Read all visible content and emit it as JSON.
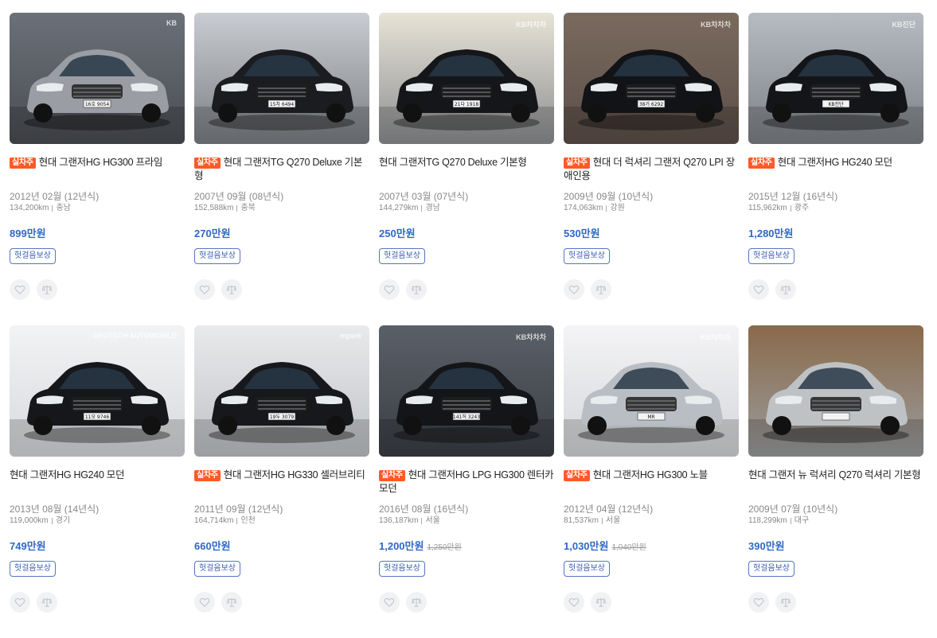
{
  "listings": [
    {
      "title": "현대 그랜저HG HG300 프라임",
      "badge": "실차주",
      "year": "2012년 02월 (12년식)",
      "mileage": "134,200km",
      "region": "충남",
      "price": "899만원",
      "old_price": "",
      "tag": "헛걸음보상",
      "car_color": "#9a9ea4",
      "bg_top": "#6b7079",
      "bg_bottom": "#4a4d52",
      "plate": "16호 9054",
      "watermark": "KB"
    },
    {
      "title": "현대 그랜저TG Q270 Deluxe 기본형",
      "badge": "실차주",
      "year": "2007년 09월 (08년식)",
      "mileage": "152,588km",
      "region": "충북",
      "price": "270만원",
      "old_price": "",
      "tag": "헛걸음보상",
      "car_color": "#1b1c20",
      "bg_top": "#c9cdd2",
      "bg_bottom": "#7b7f83",
      "plate": "15차 6494",
      "watermark": ""
    },
    {
      "title": "현대 그랜저TG Q270 Deluxe 기본형",
      "badge": "",
      "year": "2007년 03월 (07년식)",
      "mileage": "144,279km",
      "region": "경남",
      "price": "250만원",
      "old_price": "",
      "tag": "헛걸음보상",
      "car_color": "#151619",
      "bg_top": "#e7e3d6",
      "bg_bottom": "#8d8f92",
      "plate": "21다 1918",
      "watermark": "KB차차차"
    },
    {
      "title": "현대 더 럭셔리 그랜저 Q270 LPI 장애인용",
      "badge": "실차주",
      "year": "2009년 09월 (10년식)",
      "mileage": "174,063km",
      "region": "강원",
      "price": "530만원",
      "old_price": "",
      "tag": "헛걸음보상",
      "car_color": "#121316",
      "bg_top": "#7a6a5e",
      "bg_bottom": "#5c4f49",
      "plate": "38거 6292",
      "watermark": "KB차차차"
    },
    {
      "title": "현대 그랜저HG HG240 모던",
      "badge": "실차주",
      "year": "2015년 12월 (16년식)",
      "mileage": "115,962km",
      "region": "광주",
      "price": "1,280만원",
      "old_price": "",
      "tag": "헛걸음보상",
      "car_color": "#141518",
      "bg_top": "#b7bcc2",
      "bg_bottom": "#7d8186",
      "plate": "KB진단",
      "watermark": "KB진단"
    },
    {
      "title": "현대 그랜저HG HG240 모던",
      "badge": "",
      "year": "2013년 08월 (14년식)",
      "mileage": "119,000km",
      "region": "경기",
      "price": "749만원",
      "old_price": "",
      "tag": "헛걸음보상",
      "car_color": "#16171a",
      "bg_top": "#f2f3f5",
      "bg_bottom": "#d7d9dc",
      "plate": "11모 9746",
      "watermark": "DEUTSCH AUTOWORLD"
    },
    {
      "title": "현대 그랜저HG HG330 셀러브리티",
      "badge": "실차주",
      "year": "2011년 09월 (12년식)",
      "mileage": "164,714km",
      "region": "인천",
      "price": "660만원",
      "old_price": "",
      "tag": "헛걸음보상",
      "car_color": "#17181b",
      "bg_top": "#e9eaec",
      "bg_bottom": "#bfc2c5",
      "plate": "19두 3079",
      "watermark": "mpark"
    },
    {
      "title": "현대 그랜저HG LPG HG300 렌터카 모던",
      "badge": "실차주",
      "year": "2016년 08월 (16년식)",
      "mileage": "136,187km",
      "region": "서울",
      "price": "1,200만원",
      "old_price": "1,250만원",
      "tag": "헛걸음보상",
      "car_color": "#141518",
      "bg_top": "#5a6068",
      "bg_bottom": "#3a3e44",
      "plate": "141허 3243",
      "watermark": "KB차차차"
    },
    {
      "title": "현대 그랜저HG HG300 노블",
      "badge": "실차주",
      "year": "2012년 04월 (12년식)",
      "mileage": "81,537km",
      "region": "서울",
      "price": "1,030만원",
      "old_price": "1,040만원",
      "tag": "헛걸음보상",
      "car_color": "#b9bec4",
      "bg_top": "#f4f4f6",
      "bg_bottom": "#d4d6d9",
      "plate": "MR",
      "watermark": "KB차차차"
    },
    {
      "title": "현대 그랜저 뉴 럭셔리 Q270 럭셔리 기본형",
      "badge": "",
      "year": "2009년 07월 (10년식)",
      "mileage": "118,299km",
      "region": "대구",
      "price": "390만원",
      "old_price": "",
      "tag": "헛걸음보상",
      "car_color": "#bfc2c4",
      "bg_top": "#8a6a4a",
      "bg_bottom": "#9a9c9e",
      "plate": "",
      "watermark": ""
    }
  ]
}
